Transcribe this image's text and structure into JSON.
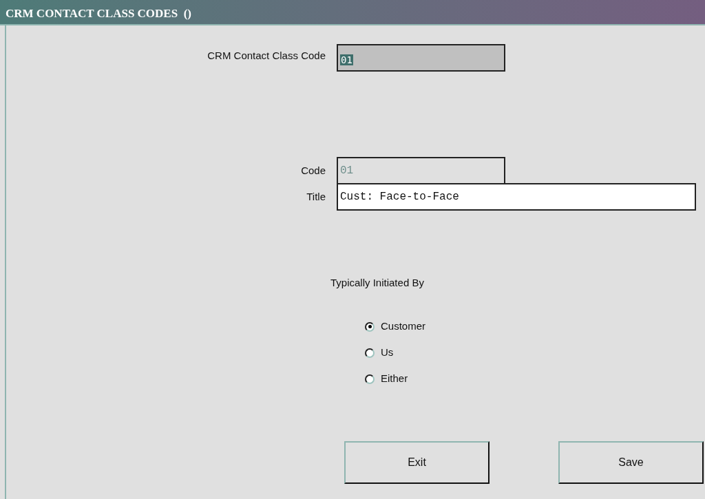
{
  "window": {
    "title": "CRM CONTACT CLASS CODES  ()"
  },
  "lookup": {
    "label": "CRM Contact Class Code",
    "value": "01"
  },
  "fields": [
    {
      "label": "Code",
      "value": "01",
      "disabled": true
    },
    {
      "label": "Title",
      "value": "Cust: Face-to-Face",
      "disabled": false
    }
  ],
  "initiated_by": {
    "label": "Typically Initiated By",
    "options": [
      {
        "label": "Customer",
        "selected": true
      },
      {
        "label": "Us",
        "selected": false
      },
      {
        "label": "Either",
        "selected": false
      }
    ]
  },
  "buttons": [
    "Exit",
    "Save"
  ]
}
